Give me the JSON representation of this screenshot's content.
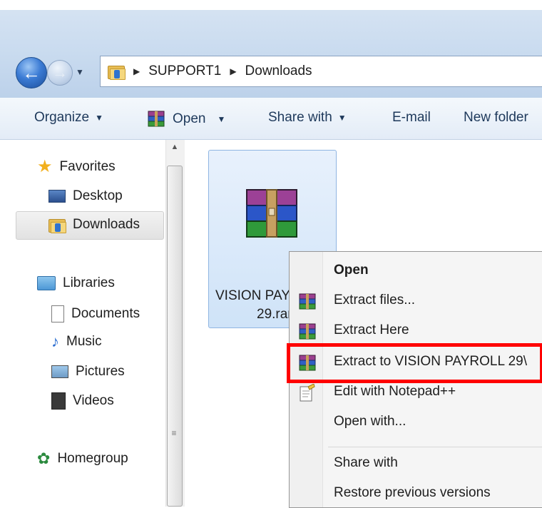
{
  "address": {
    "crumbs": [
      "SUPPORT1",
      "Downloads"
    ]
  },
  "toolbar": {
    "organize": "Organize",
    "open": "Open",
    "share_with": "Share with",
    "email": "E-mail",
    "new_folder": "New folder"
  },
  "nav": {
    "favorites": "Favorites",
    "desktop": "Desktop",
    "downloads": "Downloads",
    "libraries": "Libraries",
    "documents": "Documents",
    "music": "Music",
    "pictures": "Pictures",
    "videos": "Videos",
    "homegroup": "Homegroup"
  },
  "file": {
    "label_line1": "VISION PAY",
    "label_line2": "29.rar"
  },
  "context_menu": {
    "open": "Open",
    "extract_files": "Extract files...",
    "extract_here": "Extract Here",
    "extract_to": "Extract to VISION PAYROLL 29\\",
    "edit_notepad": "Edit with Notepad++",
    "open_with": "Open with...",
    "share_with": "Share with",
    "restore": "Restore previous versions"
  },
  "colors": {
    "highlight_box": "#ff0000",
    "titlebar": "#c9dbef"
  }
}
